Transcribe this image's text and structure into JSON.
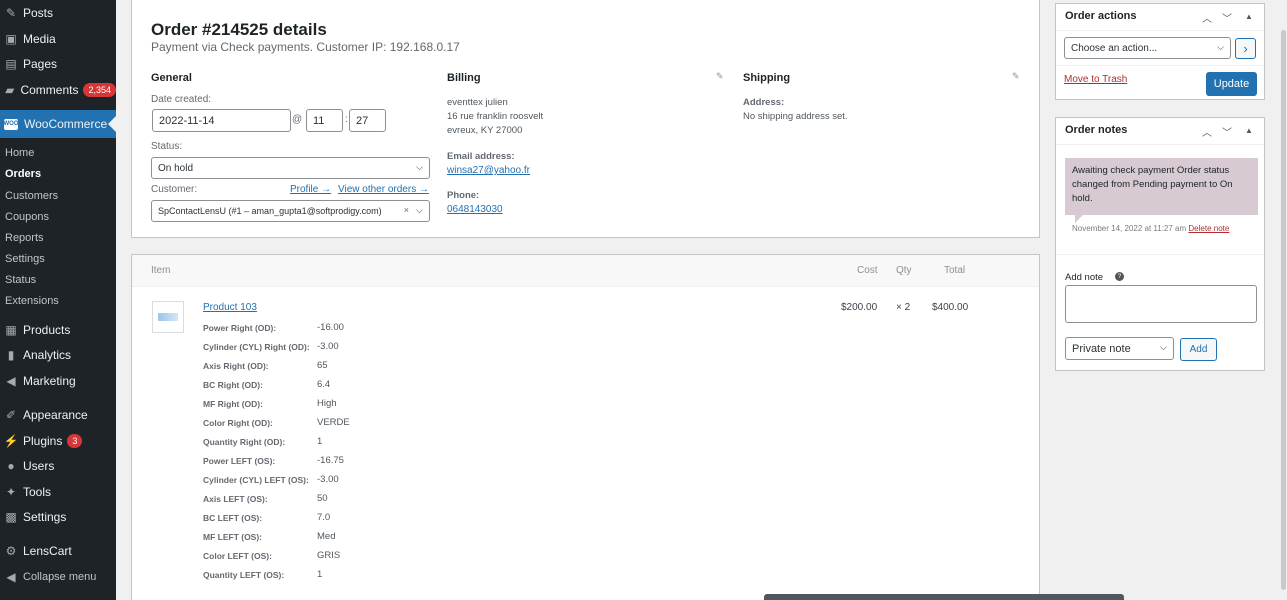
{
  "sidebar": {
    "items": [
      {
        "label": "Posts",
        "icon": "pin-icon"
      },
      {
        "label": "Media",
        "icon": "media-icon"
      },
      {
        "label": "Pages",
        "icon": "pages-icon"
      },
      {
        "label": "Comments",
        "icon": "comment-icon",
        "badge": "2,354"
      },
      {
        "label": "WooCommerce",
        "icon": "woo-icon",
        "icon_text": "WOO"
      },
      {
        "label": "Products",
        "icon": "products-icon"
      },
      {
        "label": "Analytics",
        "icon": "analytics-icon"
      },
      {
        "label": "Marketing",
        "icon": "megaphone-icon"
      },
      {
        "label": "Appearance",
        "icon": "brush-icon"
      },
      {
        "label": "Plugins",
        "icon": "plug-icon",
        "badge": "3"
      },
      {
        "label": "Users",
        "icon": "users-icon"
      },
      {
        "label": "Tools",
        "icon": "wrench-icon"
      },
      {
        "label": "Settings",
        "icon": "settings-icon"
      },
      {
        "label": "LensCart",
        "icon": "gear-icon"
      },
      {
        "label": "Collapse menu",
        "icon": "collapse-icon"
      }
    ],
    "woo_submenu": [
      "Home",
      "Orders",
      "Customers",
      "Coupons",
      "Reports",
      "Settings",
      "Status",
      "Extensions"
    ]
  },
  "order": {
    "title": "Order #214525 details",
    "meta": "Payment via Check payments. Customer IP: 192.168.0.17",
    "general": {
      "heading": "General",
      "date_label": "Date created:",
      "date": "2022-11-14",
      "at": "@",
      "hour": "11",
      "colon": ":",
      "minute": "27",
      "status_label": "Status:",
      "status": "On hold",
      "customer_label": "Customer:",
      "profile_link": "Profile →",
      "other_orders_link": "View other orders →",
      "customer": "SpContactLensU (#1 – aman_gupta1@softprodigy.com)",
      "clear": "×"
    },
    "billing": {
      "heading": "Billing",
      "address": [
        "eventtex julien",
        "16 rue franklin roosvelt",
        "evreux, KY 27000"
      ],
      "email_label": "Email address:",
      "email": "winsa27@yahoo.fr",
      "phone_label": "Phone:",
      "phone": "0648143030"
    },
    "shipping": {
      "heading": "Shipping",
      "address_label": "Address:",
      "address": "No shipping address set."
    }
  },
  "items": {
    "headers": {
      "item": "Item",
      "cost": "Cost",
      "qty": "Qty",
      "total": "Total"
    },
    "product": {
      "name": "Product 103",
      "cost": "$200.00",
      "qty": "× 2",
      "total": "$400.00",
      "meta": [
        {
          "k": "Power Right (OD):",
          "v": "-16.00"
        },
        {
          "k": "Cylinder (CYL) Right (OD):",
          "v": "-3.00"
        },
        {
          "k": "Axis Right (OD):",
          "v": "65"
        },
        {
          "k": "BC Right (OD):",
          "v": "6.4"
        },
        {
          "k": "MF Right (OD):",
          "v": "High"
        },
        {
          "k": "Color Right (OD):",
          "v": "VERDE"
        },
        {
          "k": "Quantity Right (OD):",
          "v": "1"
        },
        {
          "k": "Power LEFT (OS):",
          "v": "-16.75"
        },
        {
          "k": "Cylinder (CYL) LEFT (OS):",
          "v": "-3.00"
        },
        {
          "k": "Axis LEFT (OS):",
          "v": "50"
        },
        {
          "k": "BC LEFT (OS):",
          "v": "7.0"
        },
        {
          "k": "MF LEFT (OS):",
          "v": "Med"
        },
        {
          "k": "Color LEFT (OS):",
          "v": "GRIS"
        },
        {
          "k": "Quantity LEFT (OS):",
          "v": "1"
        }
      ]
    }
  },
  "actions": {
    "title": "Order actions",
    "select": "Choose an action...",
    "go": "›",
    "trash": "Move to Trash",
    "update": "Update"
  },
  "notes": {
    "title": "Order notes",
    "note_text": "Awaiting check payment Order status changed from Pending payment to On hold.",
    "note_date": "November 14, 2022 at 11:27 am",
    "delete": "Delete note",
    "add_label": "Add note",
    "help": "?",
    "type": "Private note",
    "add_button": "Add"
  },
  "colors": {
    "sidebar": "#1d2327",
    "accent": "#2271b1",
    "badge": "#d63638",
    "note": "#d7cad2"
  }
}
